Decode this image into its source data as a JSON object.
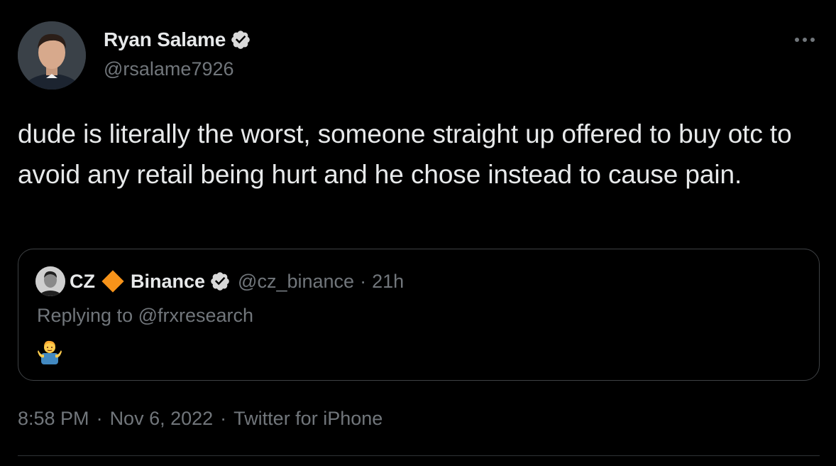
{
  "author": {
    "display_name": "Ryan Salame",
    "handle": "@rsalame7926",
    "verified_icon": "verified-badge-icon"
  },
  "tweet": {
    "text": "dude is literally the worst, someone straight up offered to buy otc to avoid any retail being hurt and he chose instead to cause pain."
  },
  "quoted_tweet": {
    "name_prefix": "CZ",
    "name_suffix": "Binance",
    "handle": "@cz_binance",
    "separator": "·",
    "time": "21h",
    "replying_to": "Replying to @frxresearch",
    "emoji_icon": "person-shrugging-emoji-icon"
  },
  "meta": {
    "time": "8:58 PM",
    "date": "Nov 6, 2022",
    "source": "Twitter for iPhone",
    "separator": "·"
  },
  "colors": {
    "background": "#000000",
    "text_primary": "#e7e9ea",
    "text_secondary": "#71767b",
    "verified": "#d9d9d9",
    "binance_diamond": "#f7931a",
    "border": "#3e4144"
  }
}
